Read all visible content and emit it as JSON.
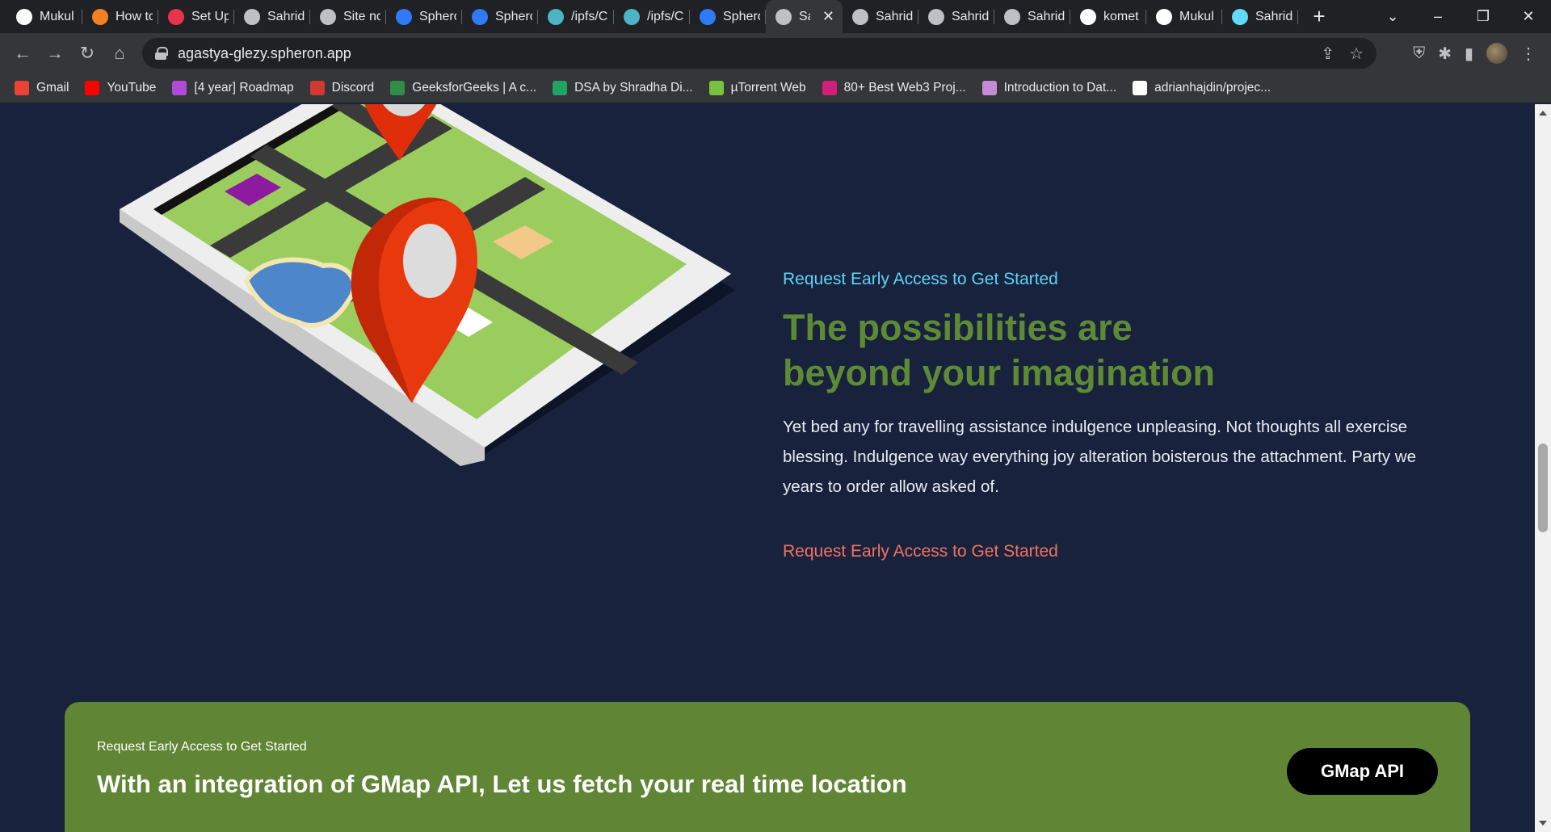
{
  "browser": {
    "tabs": [
      {
        "title": "Mukul",
        "icon": "github-icon",
        "color": "#ffffff"
      },
      {
        "title": "How to",
        "icon": "stackoverflow-icon",
        "color": "#f48024"
      },
      {
        "title": "Set Up",
        "icon": "app-icon",
        "color": "#e8334a"
      },
      {
        "title": "Sahrid",
        "icon": "globe-icon",
        "color": "#bdc1c6"
      },
      {
        "title": "Site no",
        "icon": "globe-icon",
        "color": "#bdc1c6"
      },
      {
        "title": "Sphero",
        "icon": "spheron-icon",
        "color": "#2f7bf5"
      },
      {
        "title": "Sphero",
        "icon": "spheron-icon",
        "color": "#2f7bf5"
      },
      {
        "title": "/ipfs/C",
        "icon": "ipfs-icon",
        "color": "#4cb4c4"
      },
      {
        "title": "/ipfs/C",
        "icon": "ipfs-icon",
        "color": "#4cb4c4"
      },
      {
        "title": "Sphero",
        "icon": "spheron-icon",
        "color": "#2f7bf5"
      },
      {
        "title": "Sal",
        "icon": "globe-icon",
        "color": "#bdc1c6",
        "active": true
      },
      {
        "title": "Sahrid",
        "icon": "globe-icon",
        "color": "#bdc1c6"
      },
      {
        "title": "Sahrid",
        "icon": "globe-icon",
        "color": "#bdc1c6"
      },
      {
        "title": "Sahrid",
        "icon": "globe-icon",
        "color": "#bdc1c6"
      },
      {
        "title": "komet",
        "icon": "google-icon",
        "color": "#ffffff"
      },
      {
        "title": "Mukul",
        "icon": "github-icon",
        "color": "#ffffff"
      },
      {
        "title": "Sahrid",
        "icon": "react-icon",
        "color": "#61dafb"
      }
    ],
    "url": "agastya-glezy.spheron.app",
    "bookmarks": [
      {
        "label": "Gmail",
        "icon": "gmail-icon",
        "color": "#ea4335"
      },
      {
        "label": "YouTube",
        "icon": "youtube-icon",
        "color": "#ff0000"
      },
      {
        "label": "[4 year] Roadmap",
        "icon": "roadmap-icon",
        "color": "#b04ad8"
      },
      {
        "label": "Discord",
        "icon": "discord-icon",
        "color": "#d03a2f"
      },
      {
        "label": "GeeksforGeeks | A c...",
        "icon": "gfg-icon",
        "color": "#2f8d46"
      },
      {
        "label": "DSA by Shradha Di...",
        "icon": "sheets-icon",
        "color": "#1fa463"
      },
      {
        "label": "µTorrent Web",
        "icon": "utorrent-icon",
        "color": "#78c23f"
      },
      {
        "label": "80+ Best Web3 Proj...",
        "icon": "star-bookmark-icon",
        "color": "#d21f7a"
      },
      {
        "label": "Introduction to Dat...",
        "icon": "avatar-bookmark-icon",
        "color": "#c58bd4"
      },
      {
        "label": "adrianhajdin/projec...",
        "icon": "github-icon",
        "color": "#ffffff"
      }
    ]
  },
  "page": {
    "feature": {
      "eyebrow": "Request Early Access to Get Started",
      "headline": "The possibilities are beyond your imagination",
      "body": "Yet bed any for travelling assistance indulgence unpleasing. Not thoughts all exercise blessing. Indulgence way everything joy alteration boisterous the attachment. Party we years to order allow asked of.",
      "cta": "Request Early Access to Get Started"
    },
    "banner": {
      "eyebrow": "Request Early Access to Get Started",
      "title": "With an integration of GMap API, Let us fetch your real time location",
      "button": "GMap API"
    }
  },
  "colors": {
    "page_bg": "#18223d",
    "eyebrow": "#5fd4f4",
    "headline": "#5f8a35",
    "cta": "#f2735e",
    "banner_bg": "#5f8535"
  }
}
